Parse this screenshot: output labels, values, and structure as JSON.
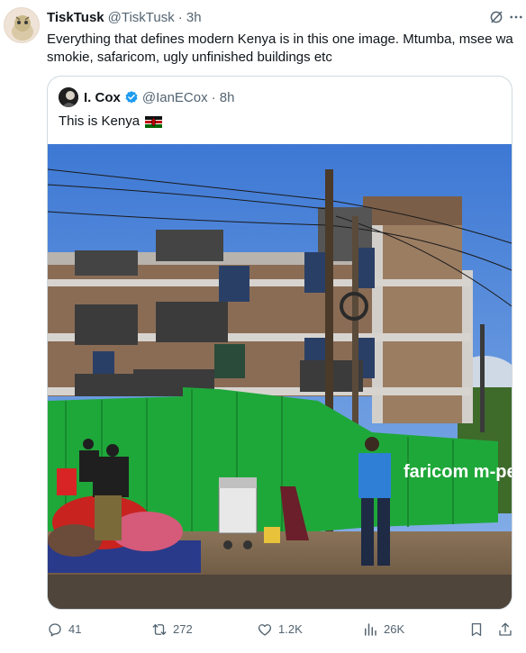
{
  "post": {
    "author": "TiskTusk",
    "handle": "@TiskTusk",
    "time": "· 3h",
    "text": "Everything that defines modern Kenya is in this one image. Mtumba, msee wa smokie, safaricom, ugly unfinished buildings etc"
  },
  "quote": {
    "author": "I. Cox",
    "handle": "@IanECox",
    "time": "· 8h",
    "text": "This is Kenya",
    "photo_signage": "faricom  m-pesa"
  },
  "actions": {
    "replies": "41",
    "reposts": "272",
    "likes": "1.2K",
    "views": "26K"
  },
  "icons": [
    "grok-icon",
    "more-icon",
    "verified-badge-icon",
    "kenya-flag-icon",
    "reply-icon",
    "repost-icon",
    "like-icon",
    "views-icon",
    "bookmark-icon",
    "share-icon"
  ],
  "colors": {
    "text": "#0f1419",
    "muted": "#536471",
    "border": "#cfd9de",
    "verified": "#1d9bf0"
  }
}
